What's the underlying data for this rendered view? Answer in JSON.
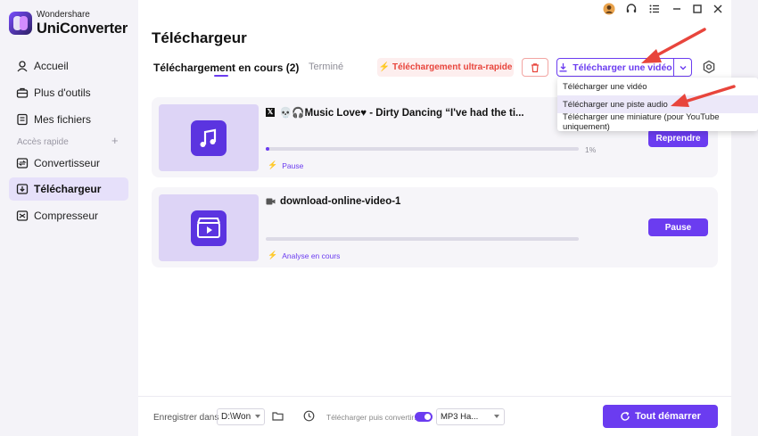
{
  "brand": {
    "small": "Wondershare",
    "big": "UniConverter"
  },
  "sidebar": {
    "items": [
      {
        "label": "Accueil",
        "icon": "home-icon"
      },
      {
        "label": "Plus d'outils",
        "icon": "toolbox-icon"
      },
      {
        "label": "Mes fichiers",
        "icon": "file-icon"
      }
    ],
    "section_label": "Accès rapide",
    "section_plus": "+",
    "quick": [
      {
        "label": "Convertisseur",
        "icon": "convert-icon"
      },
      {
        "label": "Téléchargeur",
        "icon": "download-icon"
      },
      {
        "label": "Compresseur",
        "icon": "compress-icon"
      }
    ]
  },
  "header": {
    "title": "Téléchargeur",
    "tab_active": "Téléchargement en cours (2)",
    "tab_done": "Terminé",
    "ultra_label": "Téléchargement ultra-rapide",
    "download_video_label": "Télécharger une vidéo"
  },
  "menu": {
    "items": [
      "Télécharger une vidéo",
      "Télécharger une piste audio",
      "Télécharger une miniature (pour YouTube uniquement)"
    ]
  },
  "downloads": [
    {
      "title": "💀🎧Music Love♥ - Dirty Dancing “I've had the ti...",
      "progress": 0.01,
      "percent_label": "1%",
      "status": "Pause",
      "action": "Reprendre"
    },
    {
      "title": "download-online-video-1",
      "progress": 0,
      "percent_label": "",
      "status": "Analyse en cours",
      "action": "Pause"
    }
  ],
  "footer": {
    "save_label": "Enregistrer dans",
    "save_path": "D:\\Won",
    "convert_label": "Télécharger puis convertir:",
    "format": "MP3 Ha...",
    "start_label": "Tout démarrer"
  },
  "colors": {
    "accent": "#6b3cf0",
    "danger": "#e8453c",
    "selected_bg": "#e6e0fa"
  }
}
